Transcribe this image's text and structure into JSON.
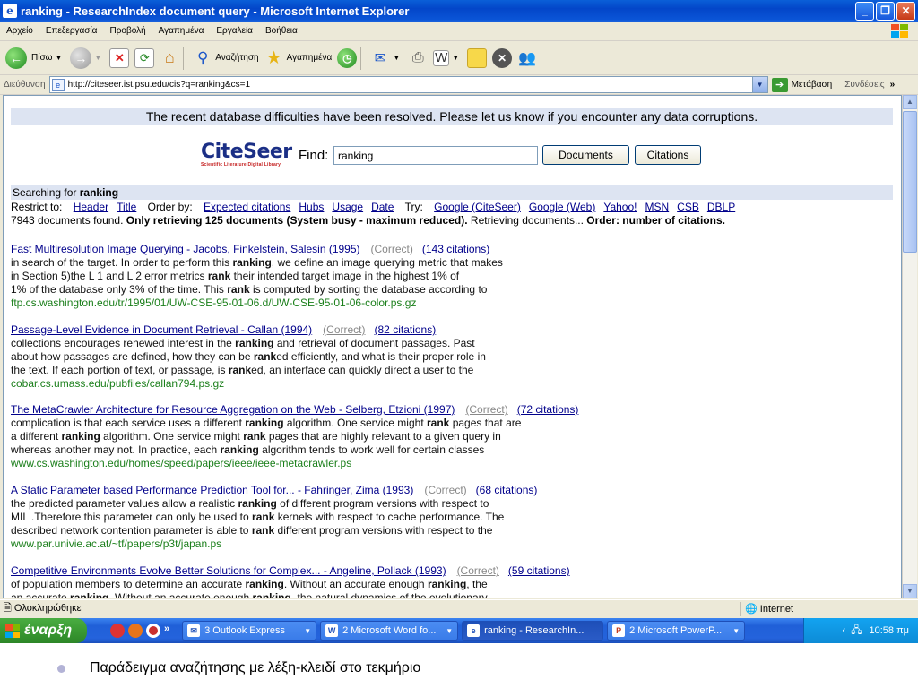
{
  "window": {
    "title": "ranking - ResearchIndex document query - Microsoft Internet Explorer"
  },
  "menu": [
    "Αρχείο",
    "Επεξεργασία",
    "Προβολή",
    "Αγαπημένα",
    "Εργαλεία",
    "Βοήθεια"
  ],
  "toolbar": {
    "back": "Πίσω",
    "search": "Αναζήτηση",
    "favorites": "Αγαπημένα"
  },
  "address": {
    "label": "Διεύθυνση",
    "url": "http://citeseer.ist.psu.edu/cis?q=ranking&cs=1",
    "go": "Μετάβαση",
    "links": "Συνδέσεις"
  },
  "page": {
    "banner": "The recent database difficulties have been resolved. Please let us know if you encounter any data corruptions.",
    "logo": "CiteSeer",
    "logo_tagline": "Scientific Literature Digital Library",
    "find_label": "Find:",
    "query": "ranking",
    "btn_documents": "Documents",
    "btn_citations": "Citations",
    "searching_prefix": "Searching for ",
    "searching_term": "ranking",
    "restrict_label": "Restrict to:",
    "restrict": [
      "Header",
      "Title"
    ],
    "order_label": "Order by:",
    "order": [
      "Expected citations",
      "Hubs",
      "Usage",
      "Date"
    ],
    "try_label": "Try:",
    "try": [
      "Google (CiteSeer)",
      "Google (Web)",
      "Yahoo!",
      "MSN",
      "CSB",
      "DBLP"
    ],
    "found_text": "7943 documents found. ",
    "found_bold": "Only retrieving 125 documents (System busy - maximum reduced).",
    "found_mid": " Retrieving documents... ",
    "found_bold2": "Order: number of citations.",
    "correct_label": "(Correct)"
  },
  "results": [
    {
      "title": "Fast Multiresolution Image Querying - Jacobs, Finkelstein, Salesin (1995)",
      "citations": "(143 citations)",
      "lines": [
        [
          "in search of the target. In order to perform this ",
          "ranking",
          ", we define an image querying metric that makes"
        ],
        [
          "in Section 5)the L 1 and L 2 error metrics ",
          "rank",
          " their intended target image in the highest 1% of"
        ],
        [
          "1% of the database only 3% of the time. This ",
          "rank",
          " is computed by sorting the database according to"
        ]
      ],
      "url": "ftp.cs.washington.edu/tr/1995/01/UW-CSE-95-01-06.d/UW-CSE-95-01-06-color.ps.gz"
    },
    {
      "title": "Passage-Level Evidence in Document Retrieval - Callan (1994)",
      "citations": "(82 citations)",
      "lines": [
        [
          "collections encourages renewed interest in the ",
          "ranking",
          " and retrieval of document passages. Past"
        ],
        [
          "about how passages are defined, how they can be ",
          "rank",
          "ed efficiently, and what is their proper role in"
        ],
        [
          "the text. If each portion of text, or passage, is ",
          "rank",
          "ed, an interface can quickly direct a user to the"
        ]
      ],
      "url": "cobar.cs.umass.edu/pubfiles/callan794.ps.gz"
    },
    {
      "title": "The MetaCrawler Architecture for Resource Aggregation on the Web - Selberg, Etzioni (1997)",
      "citations": "(72 citations)",
      "lines": [
        [
          "complication is that each service uses a different ",
          "ranking",
          " algorithm. One service might ",
          "rank",
          " pages that are"
        ],
        [
          "a different ",
          "ranking",
          " algorithm. One service might ",
          "rank",
          " pages that are highly relevant to a given query in"
        ],
        [
          "whereas another may not. In practice, each ",
          "ranking",
          " algorithm tends to work well for certain classes"
        ]
      ],
      "url": "www.cs.washington.edu/homes/speed/papers/ieee/ieee-metacrawler.ps"
    },
    {
      "title": "A Static Parameter based Performance Prediction Tool for... - Fahringer, Zima (1993)",
      "citations": "(68 citations)",
      "lines": [
        [
          "the predicted parameter values allow a realistic ",
          "ranking",
          " of different program versions with respect to"
        ],
        [
          "MIL .Therefore this parameter can only be used to ",
          "rank",
          " kernels with respect to cache performance. The"
        ],
        [
          "described network contention parameter is able to ",
          "rank",
          " different program versions with respect to the"
        ]
      ],
      "url": "www.par.univie.ac.at/~tf/papers/p3t/japan.ps"
    },
    {
      "title": "Competitive Environments Evolve Better Solutions for Complex... - Angeline, Pollack (1993)",
      "citations": "(59 citations)",
      "lines": [
        [
          "of population members to determine an accurate ",
          "ranking",
          ". Without an accurate enough ",
          "ranking",
          ", the"
        ],
        [
          "an accurate ",
          "ranking",
          ". Without an accurate enough ",
          "ranking",
          ", the natural dynamics of the evolutionary"
        ]
      ],
      "url": ""
    }
  ],
  "status": {
    "text": "Ολοκληρώθηκε",
    "zone": "Internet"
  },
  "taskbar": {
    "start": "έναρξη",
    "tasks": [
      "3 Outlook Express",
      "2 Microsoft Word fo...",
      "ranking - ResearchIn...",
      "2 Microsoft PowerP..."
    ],
    "lang": "EN",
    "clock": "10:58 πμ"
  },
  "caption": "Παράδειγμα αναζήτησης με λέξη-κλειδί στο τεκμήριο"
}
